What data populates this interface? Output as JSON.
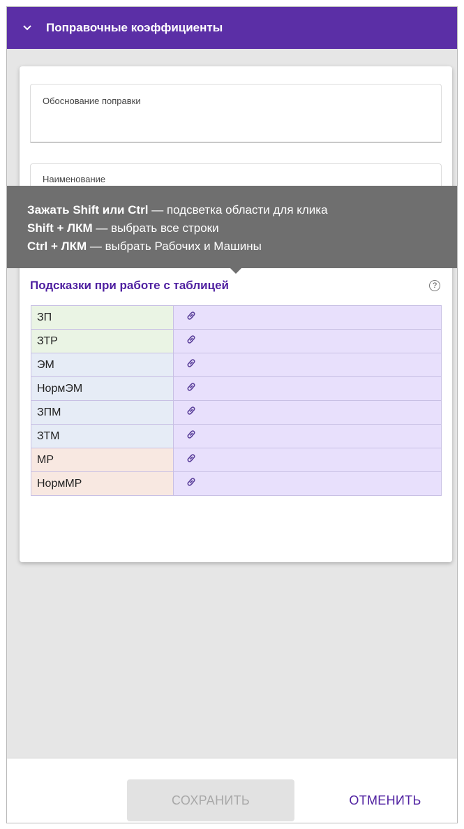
{
  "panel": {
    "title": "Поправочные коэффициенты",
    "chevron_icon": "chevron-down-icon",
    "header_color": "#5b2fa6"
  },
  "form": {
    "justification_label": "Обоснование поправки",
    "name_label": "Наименование"
  },
  "tooltip": {
    "line1_bold": "Зажать Shift или Ctrl",
    "line1_rest": " — подсветка области для клика",
    "line2_bold": "Shift + ЛКМ",
    "line2_rest": " — выбрать все строки",
    "line3_bold": "Ctrl + ЛКМ",
    "line3_rest": " — выбрать Рабочих и Машины"
  },
  "hints": {
    "title": "Подсказки при работе с таблицей",
    "help_icon": "question-circle-icon",
    "help_glyph": "?"
  },
  "table": {
    "rows": [
      {
        "name": "ЗП",
        "color": "#eaf4e4"
      },
      {
        "name": "ЗТР",
        "color": "#eaf4e4"
      },
      {
        "name": "ЭМ",
        "color": "#e6ecf6"
      },
      {
        "name": "НормЭМ",
        "color": "#e6ecf6"
      },
      {
        "name": "ЗПМ",
        "color": "#e6ecf6"
      },
      {
        "name": "ЗТМ",
        "color": "#e6ecf6"
      },
      {
        "name": "МР",
        "color": "#f8e8e1"
      },
      {
        "name": "НормМР",
        "color": "#f8e8e1"
      }
    ],
    "link_icon": "link-icon",
    "link_color": "#e8e0fc"
  },
  "footer": {
    "save_label": "СОХРАНИТЬ",
    "cancel_label": "ОТМЕНИТЬ",
    "accent": "#4e1fa0"
  }
}
